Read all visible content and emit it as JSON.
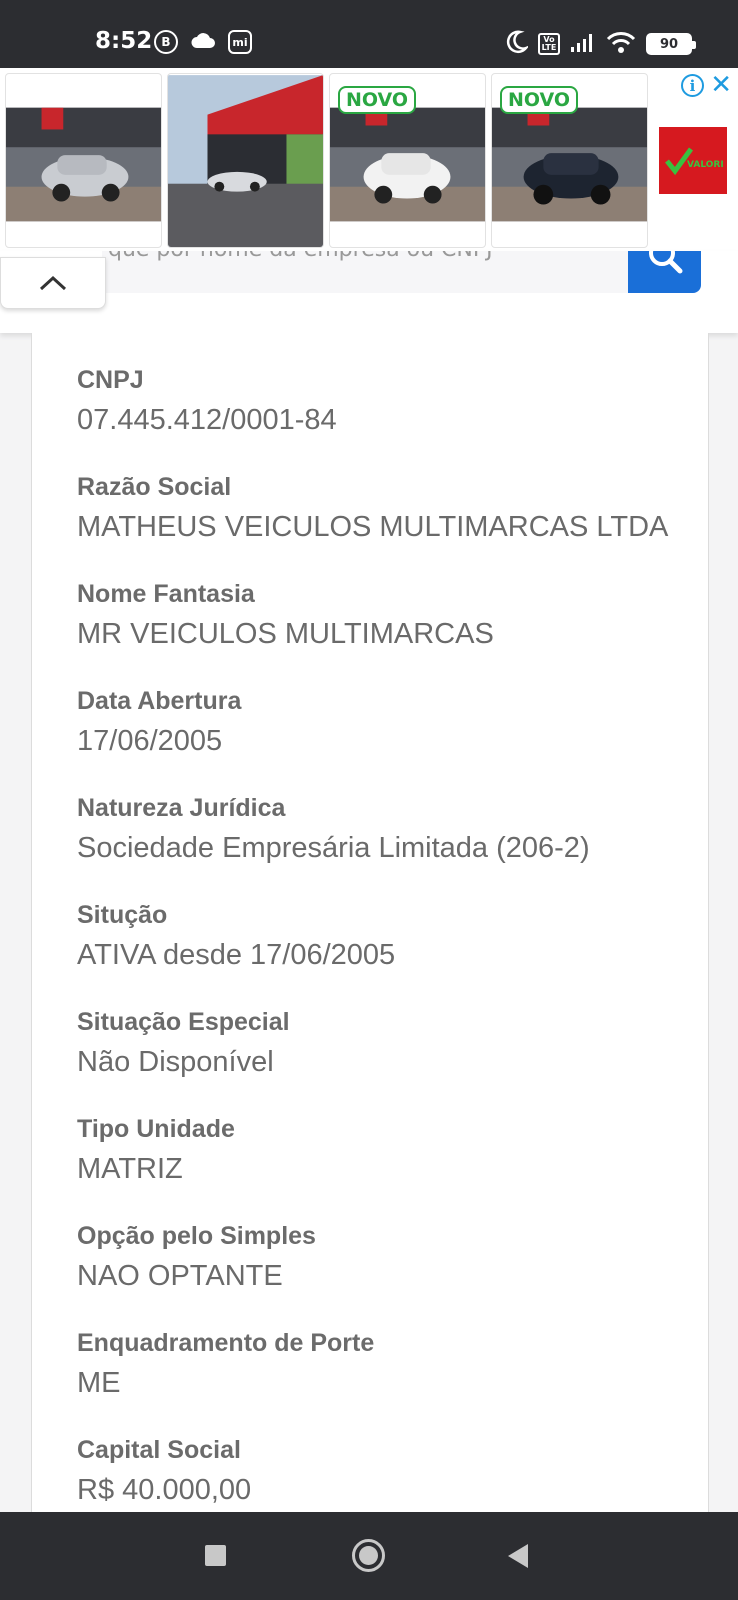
{
  "status_bar": {
    "time": "8:52",
    "left_icons": [
      "b-badge-icon",
      "cloud-icon",
      "mi-icon"
    ],
    "badge_b": "B",
    "badge_mi": "mi",
    "volte_top": "Vo",
    "volte_bottom": "LTE",
    "battery": "90"
  },
  "ad": {
    "novo_label": "NOVO",
    "info_icon": "info-icon",
    "close_icon": "close-icon",
    "logo_text": "VALORIZA"
  },
  "search": {
    "placeholder": "que por nome da empresa ou CNPJ"
  },
  "company": {
    "fields": [
      {
        "label": "CNPJ",
        "value": "07.445.412/0001-84"
      },
      {
        "label": "Razão Social",
        "value": "MATHEUS VEICULOS MULTIMARCAS LTDA"
      },
      {
        "label": "Nome Fantasia",
        "value": "MR VEICULOS MULTIMARCAS"
      },
      {
        "label": "Data Abertura",
        "value": "17/06/2005"
      },
      {
        "label": "Natureza Jurídica",
        "value": "Sociedade Empresária Limitada (206-2)"
      },
      {
        "label": "Situção",
        "value": "ATIVA desde 17/06/2005"
      },
      {
        "label": "Situação Especial",
        "value": "Não Disponível"
      },
      {
        "label": "Tipo Unidade",
        "value": "MATRIZ"
      },
      {
        "label": "Opção pelo Simples",
        "value": "NAO OPTANTE"
      },
      {
        "label": "Enquadramento de Porte",
        "value": "ME"
      },
      {
        "label": "Capital Social",
        "value": "R$ 40.000,00"
      }
    ]
  },
  "colors": {
    "status_bar_bg": "#2c2d31",
    "accent_blue": "#1a6fd8",
    "novo_green": "#2aa742",
    "text_gray": "#6a6a6a"
  }
}
